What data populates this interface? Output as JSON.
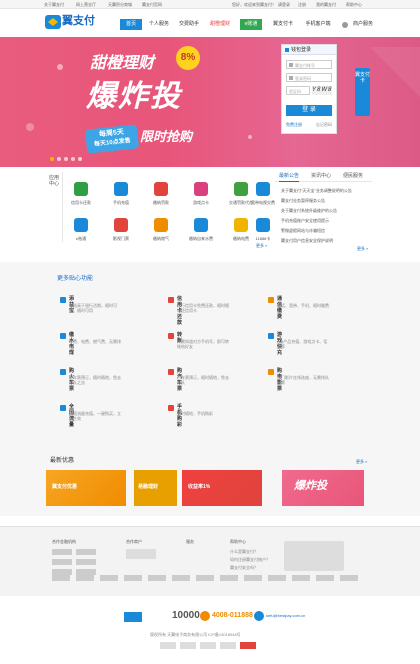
{
  "topbar": {
    "items": [
      "关于翼支付",
      "网上营业厅",
      "天翼积分商城",
      "翼支付官网"
    ],
    "right_items": [
      "您好，欢迎来到翼支付！",
      "请登录",
      "注册",
      "我的翼支付",
      "帮助中心"
    ]
  },
  "header": {
    "logo_text": "翼支付",
    "nav": [
      "首页",
      "个人服务",
      "交费助手",
      "甜橙理财",
      "e账通",
      "翼支付卡",
      "手机客户端"
    ],
    "account": "商户服务"
  },
  "banner": {
    "headline_1": "甜橙理财",
    "badge": "8%",
    "headline_2": "爆炸投",
    "sub_1": "每周5天",
    "sub_2": "每天10点发售",
    "sub_3": "限时抢购",
    "dots": 5
  },
  "login": {
    "title": "钱包登录",
    "account_placeholder": "翼支付帐号",
    "password_placeholder": "登录密码",
    "captcha_placeholder": "验证码",
    "captcha_value": "Y8W8",
    "submit": "登 录",
    "register": "免费注册",
    "forgot": "忘记密码"
  },
  "side_tab": "翼支付卡",
  "services": {
    "label": "应用中心",
    "items": [
      {
        "label": "信用卡还款",
        "color": "#2f9e44"
      },
      {
        "label": "手机充值",
        "color": "#1a8ad8"
      },
      {
        "label": "缴纳罚款",
        "color": "#e0443c"
      },
      {
        "label": "游戏点卡",
        "color": "#d94080"
      },
      {
        "label": "交通罚款代办",
        "color": "#40a040"
      },
      {
        "label": "宽带电视交费",
        "color": "#1a8ad8"
      },
      {
        "label": "e账通",
        "color": "#1a8ad8"
      },
      {
        "label": "影视门票",
        "color": "#e0443c"
      },
      {
        "label": "缴纳燃气",
        "color": "#f08c00"
      },
      {
        "label": "缴纳自来水费",
        "color": "#1a8ad8"
      },
      {
        "label": "缴纳电费",
        "color": "#f0b400"
      },
      {
        "label": "11888卡",
        "color": "#1a8ad8"
      }
    ],
    "more": "更多 »"
  },
  "news": {
    "tabs": [
      "最新公告",
      "资讯中心",
      "便民服务"
    ],
    "items": [
      "关于翼支付\"天天宝\"业务调整说明的公告",
      "翼支付业务暂停服务公告",
      "关于翼支付系统升级维护的公告",
      "手机充值账户安全使用提示",
      "警惕虚假网站与诈骗短信",
      "翼支付用户信息安全保护说明"
    ],
    "more": "更多 »"
  },
  "functions": {
    "title": "更多贴心功能",
    "items": [
      {
        "title": "添益宝",
        "desc": "收益高于银行活期，随时可取，随时可用",
        "color": "#1a8ad8"
      },
      {
        "title": "信用卡还款",
        "desc": "跨行信用卡免费还款，随时随地还信用卡",
        "color": "#e0443c"
      },
      {
        "title": "通信缴费",
        "desc": "固话、宽带、手机、随时缴费",
        "color": "#f08c00"
      },
      {
        "title": "缴水电煤",
        "desc": "水费、电费、燃气费、无需排队",
        "color": "#1a8ad8"
      },
      {
        "title": "转账",
        "desc": "只需知道对方手机号，即可转账给好友",
        "color": "#e0443c"
      },
      {
        "title": "游戏快充",
        "desc": "QQ产品充值、游戏点卡、话费等",
        "color": "#1a8ad8"
      },
      {
        "title": "购火车票",
        "desc": "火车票预订，随时随地，免去排队之苦",
        "color": "#1a8ad8"
      },
      {
        "title": "购汽车票",
        "desc": "汽车票预订，随时随地，免去排队",
        "color": "#e0443c"
      },
      {
        "title": "购电影票",
        "desc": "热门影片在线选座，无需排队取票",
        "color": "#f08c00"
      },
      {
        "title": "全国流量",
        "desc": "全国流量充值，一键购买，立即生效",
        "color": "#1a8ad8"
      },
      {
        "title": "手机购彩",
        "desc": "随时随地，手机购彩",
        "color": "#e0443c"
      }
    ]
  },
  "promotions": {
    "title": "最新优惠",
    "more": "更多 »",
    "cards": [
      {
        "label": "翼支付优惠",
        "color": "#f08c00"
      },
      {
        "label": "易融理财",
        "color": "#e8a000"
      },
      {
        "label": "收益率1%",
        "color": "#e0443c"
      },
      {
        "label": "爆炸投",
        "color": "#e8557a"
      }
    ]
  },
  "footer": {
    "cols": [
      "合作金融机构",
      "合作商户",
      "服务",
      "帮助中心"
    ],
    "help": [
      "什么是翼支付？",
      "如何注册翼支付账户？",
      "翼支付安全吗？"
    ],
    "hotline": "10000",
    "phone": "4008-011888",
    "email": "kefu@bestpay.com.cn",
    "copyright": "版权所有 天翼电子商务有限公司 ICP备13018948号"
  }
}
